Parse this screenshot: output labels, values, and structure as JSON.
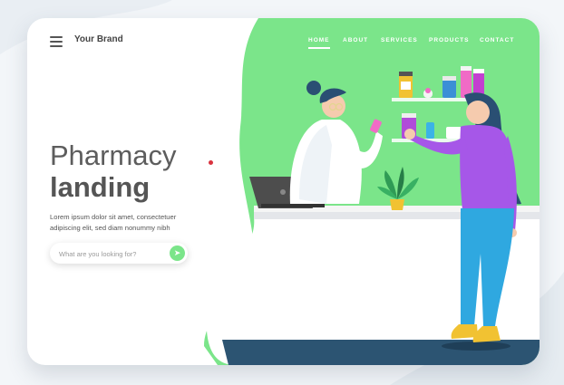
{
  "header": {
    "brand": "Your Brand",
    "menu_icon": "hamburger-menu-icon"
  },
  "nav": {
    "items": [
      {
        "label": "HOME",
        "active": true
      },
      {
        "label": "ABOUT",
        "active": false
      },
      {
        "label": "SERVICES",
        "active": false
      },
      {
        "label": "PRODUCTS",
        "active": false
      },
      {
        "label": "CONTACT",
        "active": false
      }
    ]
  },
  "hero": {
    "title_light": "Pharmacy",
    "title_bold": "landing",
    "description": "Lorem ipsum dolor sit amet, consectetuer adipiscing elit, sed diam nonummy nibh"
  },
  "search": {
    "placeholder": "What are you looking for?",
    "button_icon": "arrow-right-icon"
  },
  "colors": {
    "accent_green": "#7be58a",
    "navy_floor": "#2c5472",
    "woman_top": "#a657e8",
    "woman_pants": "#2fa8e0"
  }
}
